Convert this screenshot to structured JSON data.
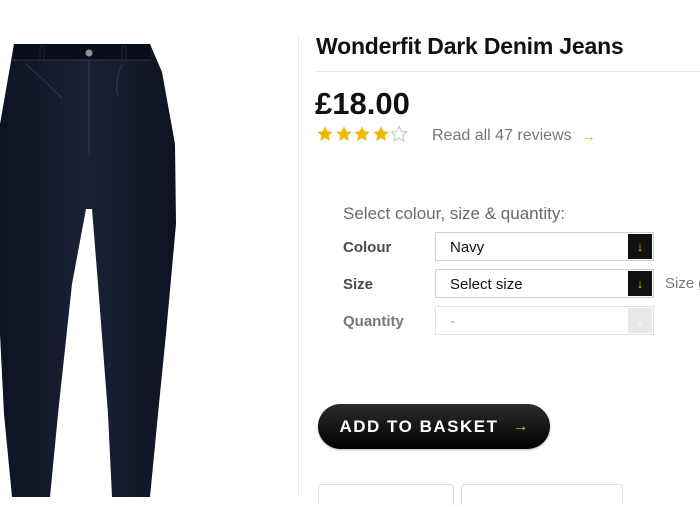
{
  "product": {
    "title": "Wonderfit Dark Denim Jeans",
    "price": "£18.00",
    "rating": 4,
    "rating_max": 5,
    "reviews_link": "Read all 47 reviews",
    "reviews_arrow": "→"
  },
  "options": {
    "heading": "Select colour, size & quantity:",
    "colour": {
      "label": "Colour",
      "value": "Navy"
    },
    "size": {
      "label": "Size",
      "value": "Select size",
      "guide": "Size g"
    },
    "quantity": {
      "label": "Quantity",
      "value": "-"
    },
    "dropdown_arrow": "↓"
  },
  "basket": {
    "label": "ADD TO BASKET",
    "arrow": "→"
  },
  "colors": {
    "accent": "#f2b705",
    "navy": "#111827",
    "button": "#000000"
  }
}
